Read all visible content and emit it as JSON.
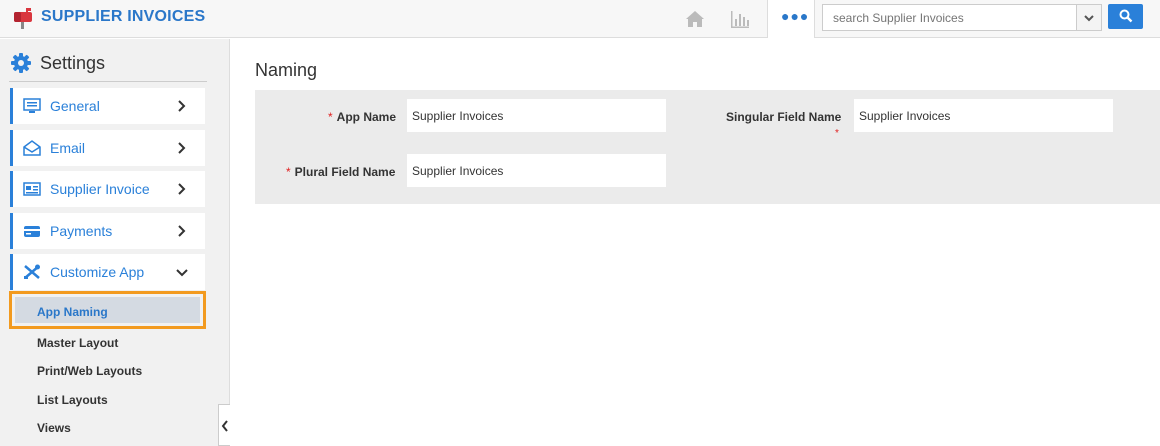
{
  "header": {
    "app_title": "SUPPLIER INVOICES",
    "logo_icon": "mailbox-icon",
    "nav_icons": [
      "home-icon",
      "bar-chart-icon",
      "more-dots-icon"
    ],
    "search": {
      "placeholder": "search Supplier Invoices",
      "value": ""
    },
    "accent_color": "#2a80d9"
  },
  "sidebar": {
    "title": "Settings",
    "items": [
      {
        "label": "General",
        "icon": "monitor-icon"
      },
      {
        "label": "Email",
        "icon": "envelope-icon"
      },
      {
        "label": "Supplier Invoice",
        "icon": "invoice-icon"
      },
      {
        "label": "Payments",
        "icon": "credit-card-icon"
      },
      {
        "label": "Customize App",
        "icon": "tools-icon",
        "expanded": true
      }
    ],
    "subitems": [
      {
        "label": "App Naming",
        "active": true
      },
      {
        "label": "Master Layout"
      },
      {
        "label": "Print/Web Layouts"
      },
      {
        "label": "List Layouts"
      },
      {
        "label": "Views"
      }
    ],
    "highlight_color": "#f29a1f"
  },
  "main": {
    "title": "Naming",
    "fields": {
      "app_name": {
        "label": "App Name",
        "value": "Supplier Invoices",
        "required": true
      },
      "singular": {
        "label": "Singular Field Name",
        "value": "Supplier Invoices",
        "required": true
      },
      "plural": {
        "label": "Plural Field Name",
        "value": "Supplier Invoices",
        "required": true
      }
    }
  }
}
